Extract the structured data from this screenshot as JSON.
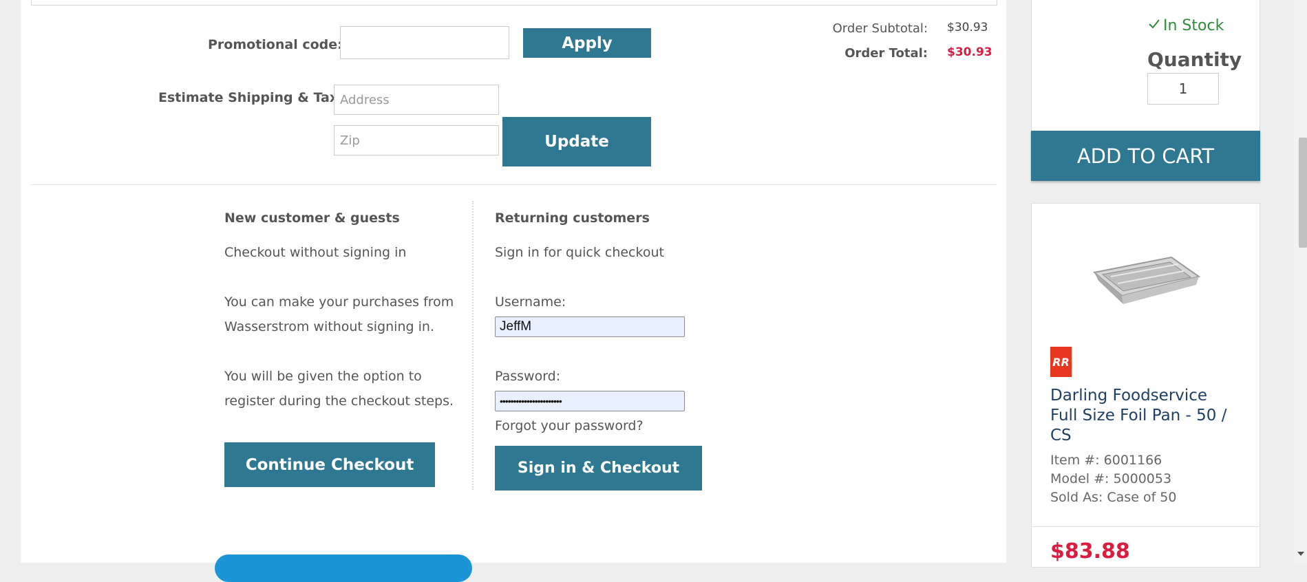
{
  "promo": {
    "label": "Promotional code:",
    "value": "",
    "apply_label": "Apply"
  },
  "totals": {
    "subtotal_label": "Order Subtotal:",
    "subtotal_value": "$30.93",
    "total_label": "Order Total:",
    "total_value": "$30.93",
    "total_color": "#d91c3f"
  },
  "shipping": {
    "label": "Estimate Shipping & Tax:",
    "address_placeholder": "Address",
    "zip_placeholder": "Zip",
    "update_label": "Update"
  },
  "guest": {
    "heading": "New customer & guests",
    "line1": "Checkout without signing in",
    "para1_line1": "You can make your purchases from",
    "para1_line2": "Wasserstrom without signing in.",
    "para2_line1": "You will be given the option to",
    "para2_line2": "register during the checkout steps.",
    "button_label": "Continue Checkout"
  },
  "returning": {
    "heading": "Returning customers",
    "line1": "Sign in for quick checkout",
    "username_label": "Username:",
    "username_value": "JeffM",
    "password_label": "Password:",
    "password_value": "•••••••••••••••••••••••",
    "forgot_label": "Forgot your password?",
    "button_label": "Sign in & Checkout"
  },
  "sidebar": {
    "stock_icon": "check-icon",
    "stock_text": "In Stock",
    "stock_color": "#2e8b3a",
    "quantity_label": "Quantity",
    "quantity_value": "1",
    "add_to_cart_label": "ADD TO CART",
    "product": {
      "brand_badge": "RR",
      "brand_color": "#e8371f",
      "image_icon": "foil-pan-image",
      "title_line1": "Darling Foodservice",
      "title_line2": "Full Size Foil Pan - 50 /",
      "title_line3": "CS",
      "item_no": "Item #: 6001166",
      "model_no": "Model #: 5000053",
      "sold_as": "Sold As: Case of 50",
      "price": "$83.88",
      "price_color": "#d91c3f"
    }
  },
  "colors": {
    "button": "#2f7891",
    "link_blue": "#1b95d6",
    "title_blue": "#1f3f63"
  }
}
